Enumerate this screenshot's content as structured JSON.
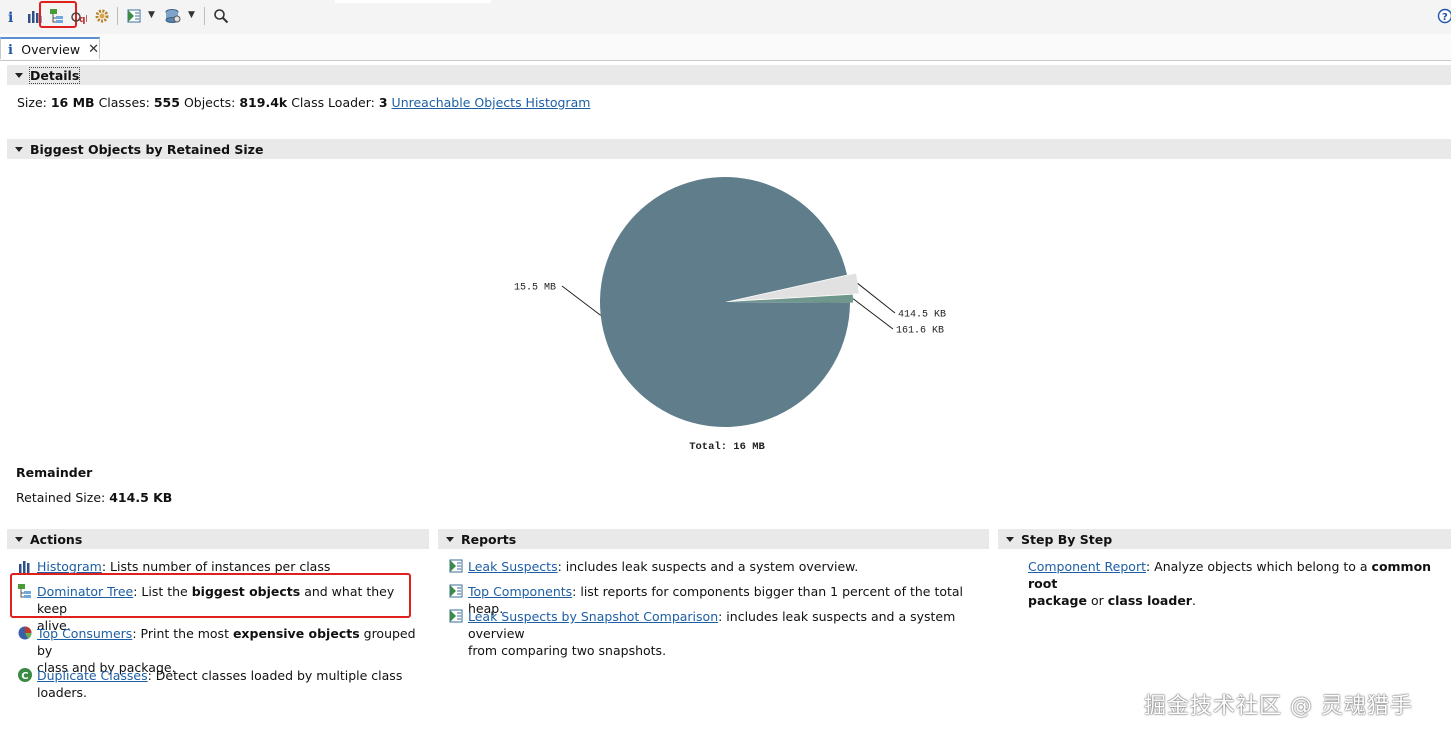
{
  "toolbar": {
    "buttons": [
      "info-icon",
      "histogram-icon",
      "dominator-tree-icon",
      "oql-icon",
      "heap-dump-overview-icon",
      "query-browser-icon",
      "find-object-icon",
      "search-icon",
      "help-icon"
    ]
  },
  "tab": {
    "label": "Overview"
  },
  "details": {
    "title": "Details",
    "size_label": "Size:",
    "size_value": "16 MB",
    "classes_label": "Classes:",
    "classes_value": "555",
    "objects_label": "Objects:",
    "objects_value": "819.4k",
    "loader_label": "Class Loader:",
    "loader_value": "3",
    "link": "Unreachable Objects Histogram"
  },
  "biggest": {
    "title": "Biggest Objects by Retained Size"
  },
  "chart_data": {
    "type": "pie",
    "slices": [
      {
        "label": "15.5 MB",
        "value": 15.5,
        "color": "#607d8b"
      },
      {
        "label": "414.5 KB",
        "value": 0.4145,
        "color": "#e1e1e1"
      },
      {
        "label": "161.6 KB",
        "value": 0.1616,
        "color": "#6f978c"
      }
    ],
    "total_label": "Total: 16 MB"
  },
  "remainder": {
    "title": "Remainder",
    "retained_label": "Retained Size:",
    "retained_value": "414.5 KB"
  },
  "actions": {
    "title": "Actions",
    "items": [
      {
        "link": "Histogram",
        "text": ": Lists number of instances per class"
      },
      {
        "link": "Dominator Tree",
        "pre": ": List the ",
        "bold": "biggest objects",
        "post": " and what they keep",
        "line2": "alive."
      },
      {
        "link": "Top Consumers",
        "pre": ": Print the most ",
        "bold": "expensive objects",
        "post": " grouped by",
        "line2": "class and by package."
      },
      {
        "link": "Duplicate Classes",
        "text": ": Detect classes loaded by multiple class",
        "line2": "loaders."
      }
    ]
  },
  "reports": {
    "title": "Reports",
    "items": [
      {
        "link": "Leak Suspects",
        "text": ": includes leak suspects and a system overview."
      },
      {
        "link": "Top Components",
        "text": ": list reports for components bigger than 1 percent of the total heap."
      },
      {
        "link": "Leak Suspects by Snapshot Comparison",
        "text": ": includes leak suspects and a system overview",
        "line2": "from comparing two snapshots."
      }
    ]
  },
  "step": {
    "title": "Step By Step",
    "link": "Component Report",
    "pre": ": Analyze objects which belong to a ",
    "bold1": "common root",
    "bold2": "package",
    "mid": " or ",
    "bold3": "class loader",
    "post": "."
  },
  "watermark": "掘金技术社区 @ 灵魂猎手",
  "colors": {
    "highlight": "#e0201c",
    "link": "#1d5fa5",
    "header_bg": "#e9e9e9"
  }
}
